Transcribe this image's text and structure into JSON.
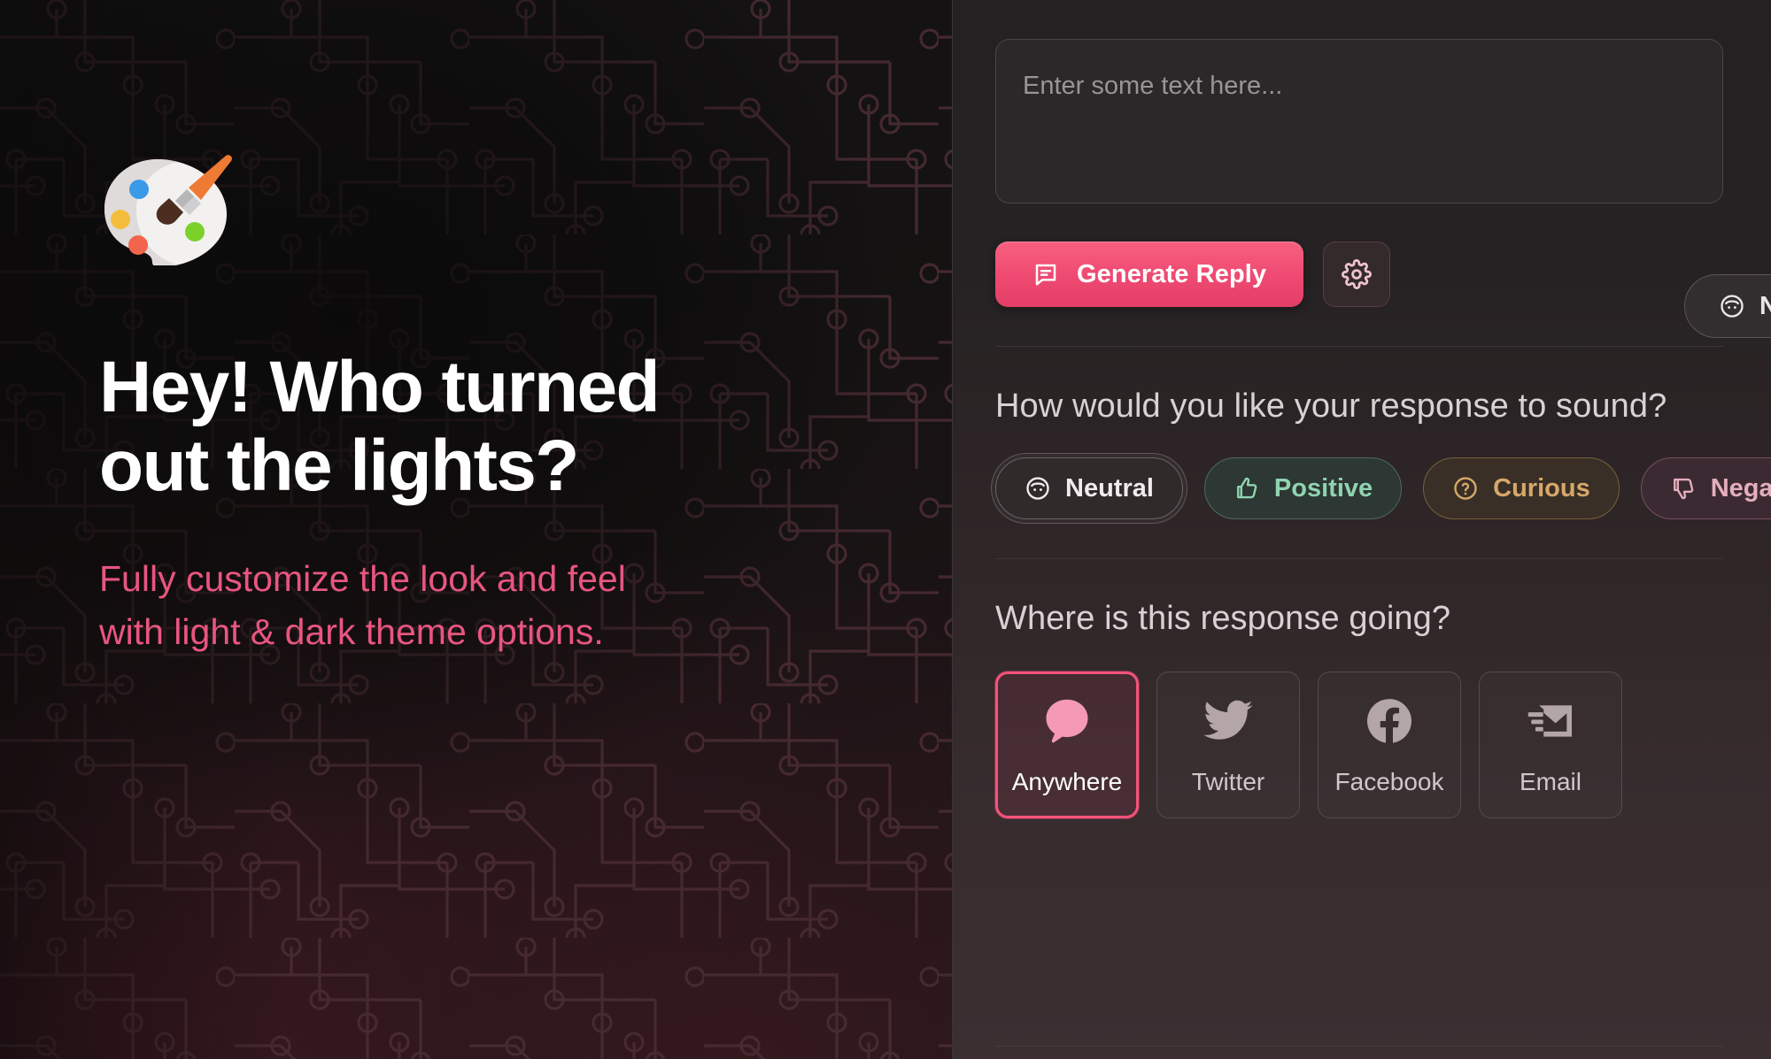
{
  "left": {
    "emoji_icon": "artist-palette-emoji",
    "headline_line1": "Hey! Who turned",
    "headline_line2": "out the lights?",
    "subhead_line1": "Fully customize the look and feel",
    "subhead_line2": "with light & dark theme options.",
    "colors": {
      "headline": "#ffffff",
      "subhead": "#e8567f",
      "background": "#141212",
      "circuit_trace": "#3d2227"
    }
  },
  "right": {
    "composer": {
      "placeholder": "Enter some text here...",
      "value": ""
    },
    "actions": {
      "generate_label": "Generate Reply",
      "generate_icon": "message-lines-icon",
      "settings_icon": "gear-icon",
      "accent_color": "#ef4a72"
    },
    "floating_pill": {
      "label": "Neutral",
      "icon": "neutral-face-icon",
      "truncated": true
    },
    "tone_section": {
      "title": "How would you like your response to sound?",
      "options": [
        {
          "label": "Neutral",
          "icon": "neutral-face-icon",
          "color": "#f0ebec",
          "selected": true
        },
        {
          "label": "Positive",
          "icon": "thumbs-up-icon",
          "color": "#8fd4b0",
          "selected": false
        },
        {
          "label": "Curious",
          "icon": "question-mark-icon",
          "color": "#d6a86a",
          "selected": false
        },
        {
          "label": "Negative",
          "icon": "thumbs-down-icon",
          "color": "#e4aebd",
          "selected": false
        }
      ]
    },
    "platform_section": {
      "title": "Where is this response going?",
      "options": [
        {
          "label": "Anywhere",
          "icon": "speech-bubble-icon",
          "selected": true
        },
        {
          "label": "Twitter",
          "icon": "twitter-bird-icon",
          "selected": false
        },
        {
          "label": "Facebook",
          "icon": "facebook-f-icon",
          "selected": false
        },
        {
          "label": "Email",
          "icon": "email-send-icon",
          "selected": false
        }
      ]
    }
  }
}
